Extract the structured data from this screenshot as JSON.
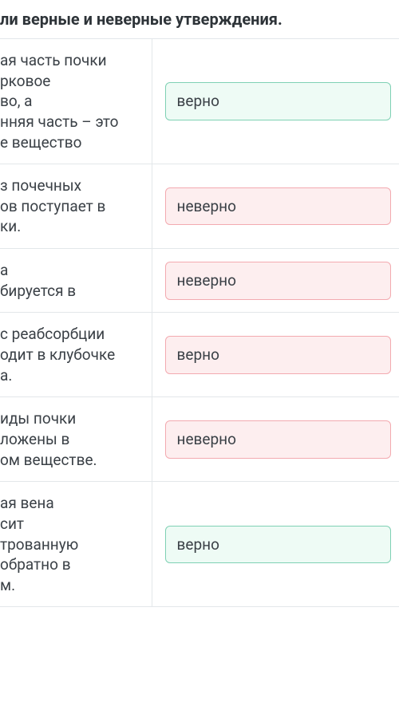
{
  "title": "ли верные и неверные утверждения.",
  "labels": {
    "true": "верно",
    "false": "неверно"
  },
  "colors": {
    "correct_border": "#7fd1b4",
    "correct_bg": "#eefbf5",
    "wrong_border": "#f3aab0",
    "wrong_bg": "#fdeeef"
  },
  "rows": [
    {
      "text_lines": [
        "ая часть почки",
        "рковое",
        "во, а",
        "нняя часть – это",
        "е вещество"
      ],
      "answer": "верно",
      "status": "correct"
    },
    {
      "text_lines": [
        "з почечных",
        "ов поступает в",
        "ки."
      ],
      "answer": "неверно",
      "status": "wrong"
    },
    {
      "text_lines": [
        "а",
        "бируется в"
      ],
      "answer": "неверно",
      "status": "wrong"
    },
    {
      "text_lines": [
        "с реабсорбции",
        "одит в клубочке",
        "а."
      ],
      "answer": "верно",
      "status": "wrong"
    },
    {
      "text_lines": [
        "иды почки",
        "ложены в",
        "ом веществе."
      ],
      "answer": "неверно",
      "status": "wrong"
    },
    {
      "text_lines": [
        "ая вена",
        "сит",
        "трованную",
        "обратно в",
        "м."
      ],
      "answer": "верно",
      "status": "correct"
    }
  ]
}
